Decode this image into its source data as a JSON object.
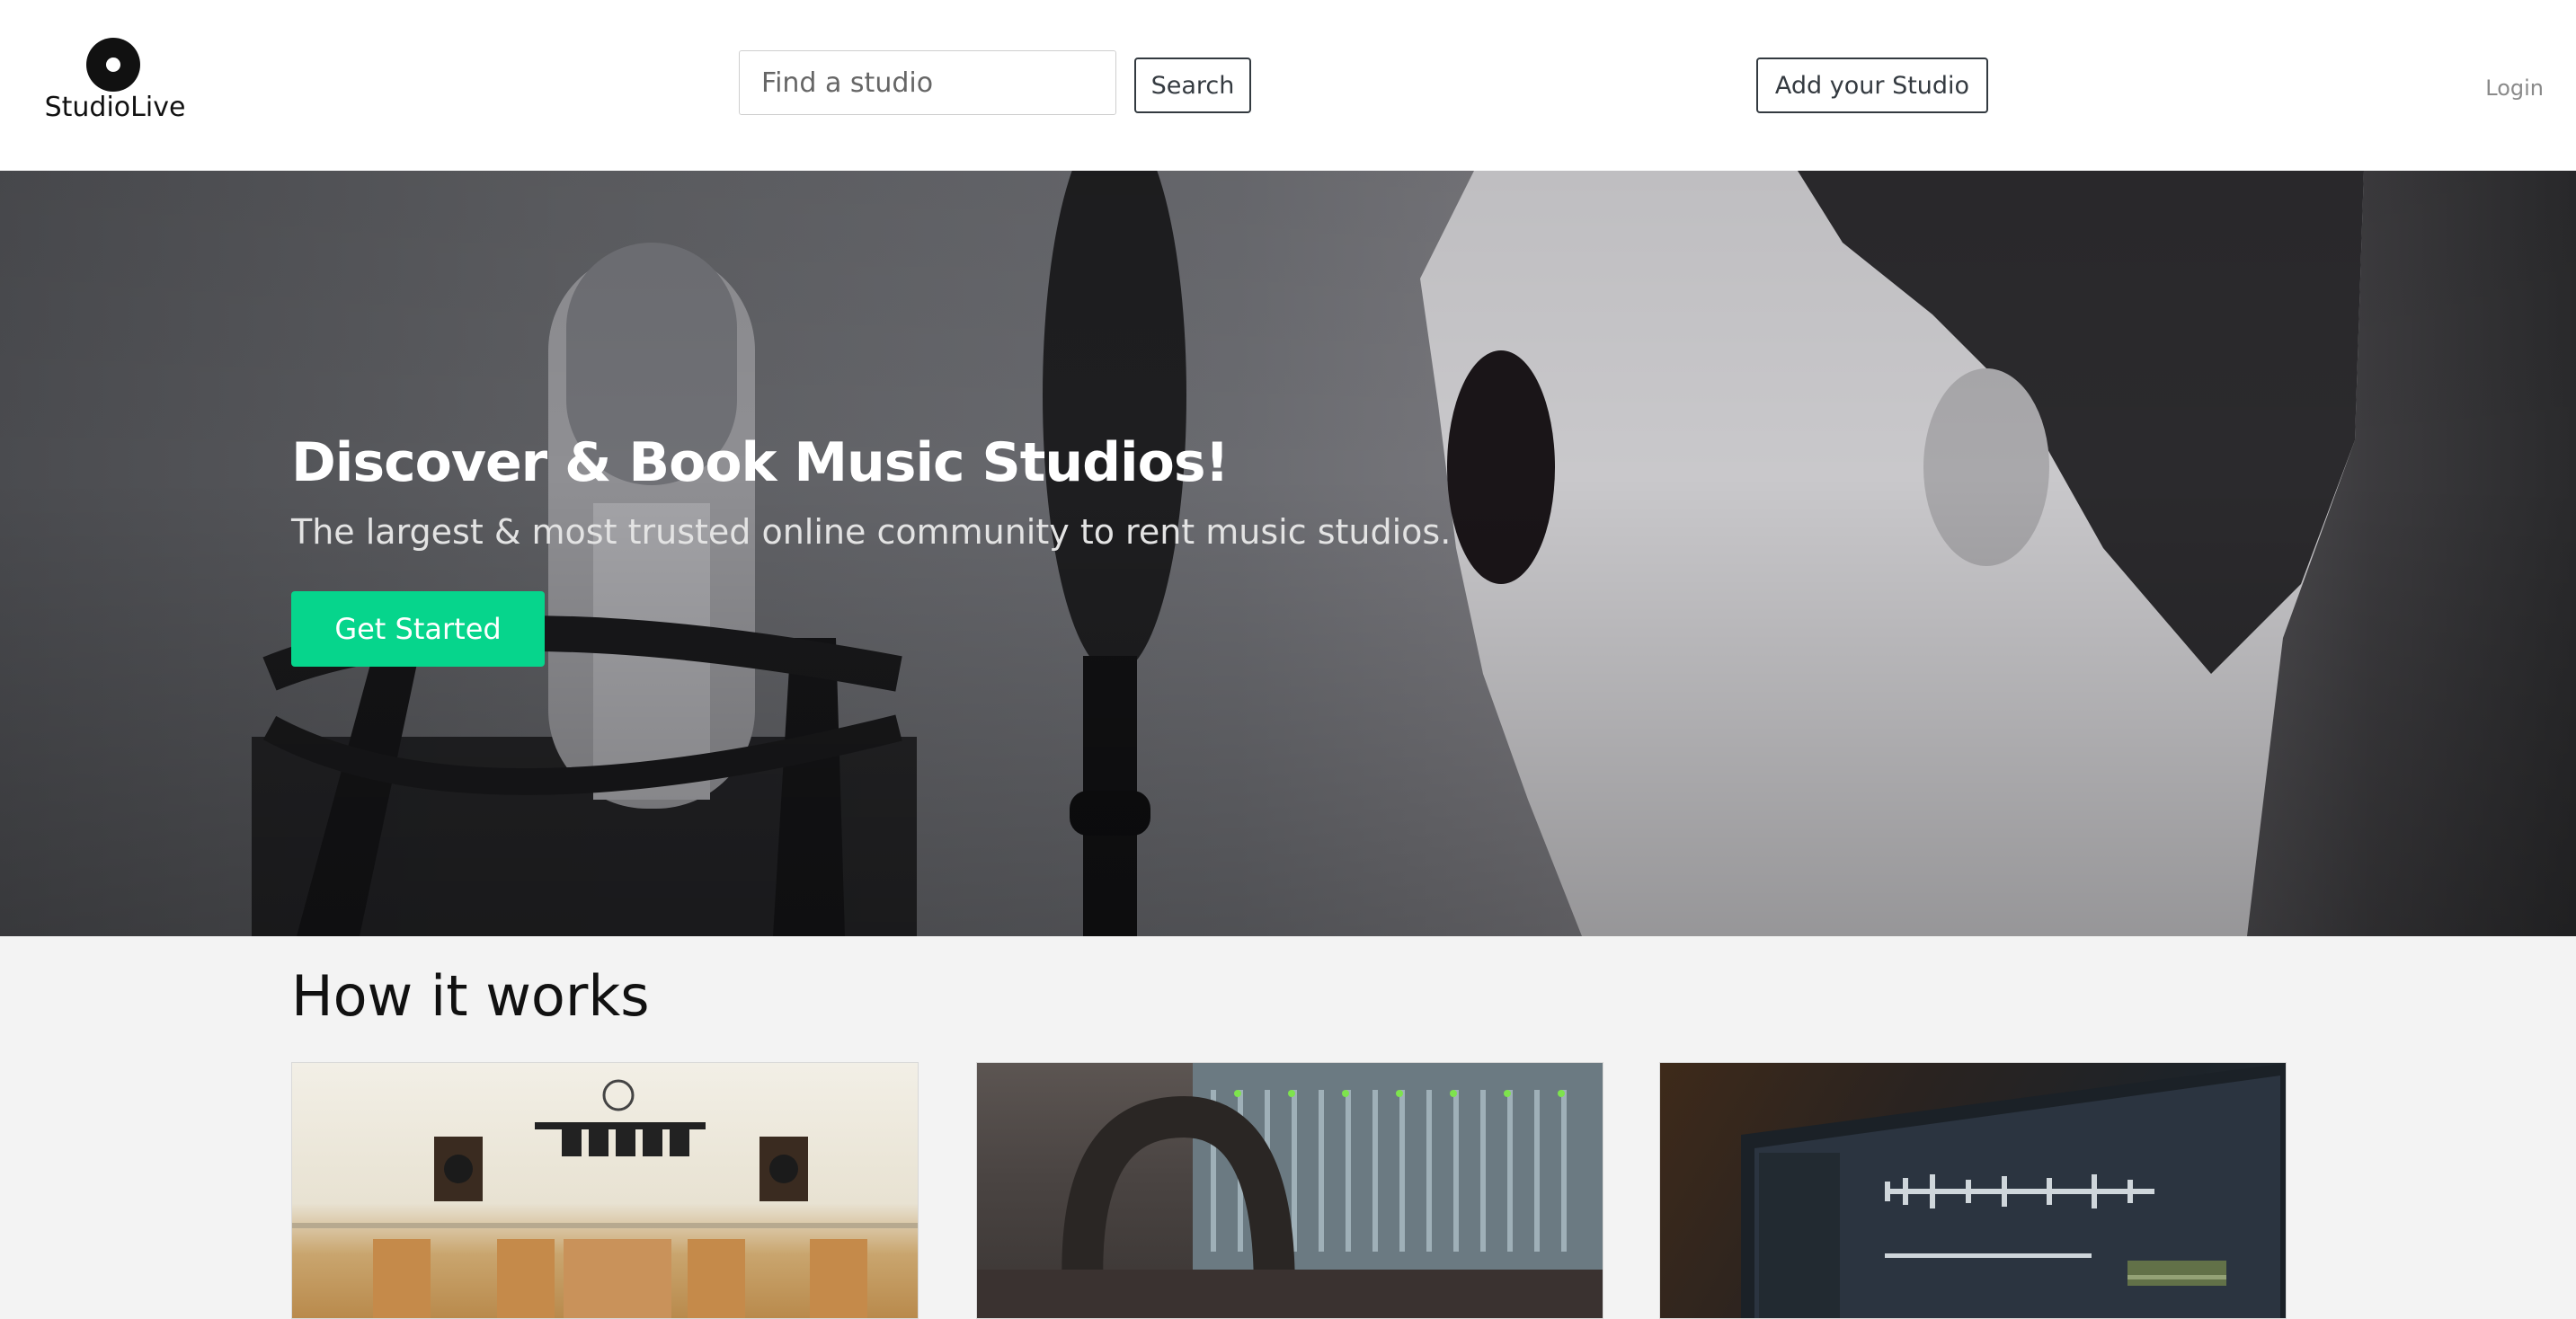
{
  "header": {
    "logo_text": "StudioLive",
    "search_placeholder": "Find a studio",
    "search_label": "Search",
    "add_studio_label": "Add your Studio",
    "login_label": "Login"
  },
  "hero": {
    "title": "Discover & Book Music Studios!",
    "subtitle": "The largest & most trusted online community to rent music studios.",
    "cta_label": "Get Started"
  },
  "how_it_works": {
    "title": "How it works"
  },
  "colors": {
    "accent": "#06d58c",
    "page_background": "#f3f3f3"
  },
  "icons": [
    "vinyl-record-logo"
  ]
}
